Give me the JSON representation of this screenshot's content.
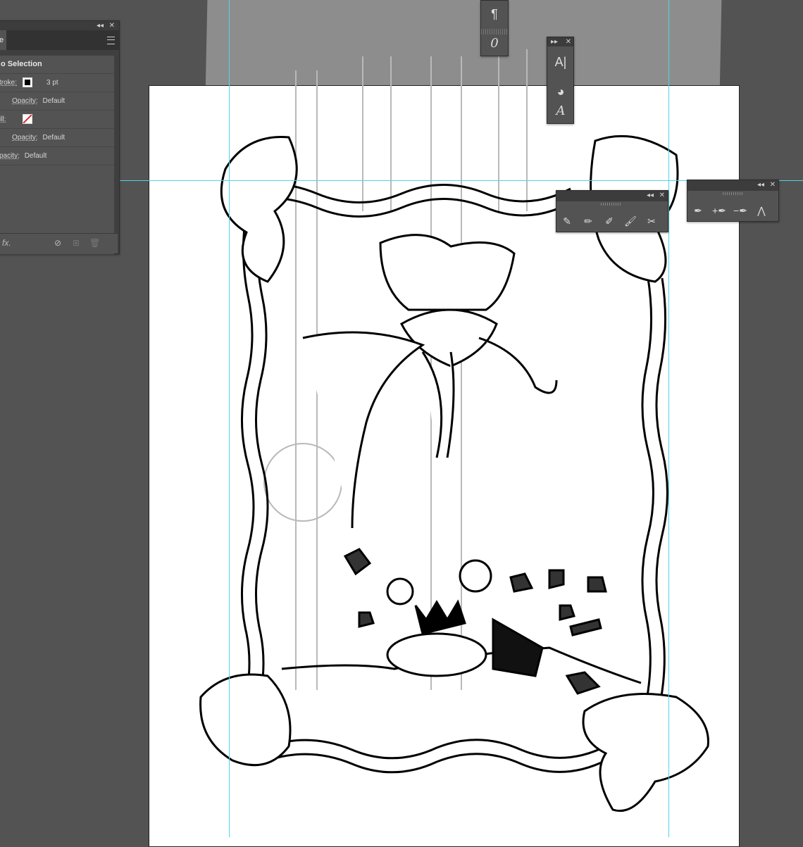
{
  "appearance": {
    "tab_label": "e",
    "selection_label": "o Selection",
    "stroke_label": "troke:",
    "stroke_weight": "3 pt",
    "stroke_opacity_label": "Opacity:",
    "stroke_opacity_value": "Default",
    "fill_label": "ill:",
    "fill_opacity_label": "Opacity:",
    "fill_opacity_value": "Default",
    "object_opacity_label": "pacity:",
    "object_opacity_value": "Default",
    "fx_label": "fx."
  },
  "panel_colors": {
    "background": "#535353",
    "dark": "#3c3c3c",
    "guide": "#4fd6e6",
    "fill_none_slash": "#e0262b"
  },
  "text_tools": [
    "paragraph-icon",
    "opentype-icon"
  ],
  "char_tools": [
    "character-icon",
    "glyph-icon",
    "italic-a-icon"
  ],
  "brush_tools": [
    "blob-brush-icon",
    "pencil-icon",
    "smooth-icon",
    "paintbrush-icon",
    "eraser-icon"
  ],
  "pen_tools": [
    "pen-icon",
    "add-anchor-icon",
    "delete-anchor-icon",
    "anchor-convert-icon"
  ]
}
